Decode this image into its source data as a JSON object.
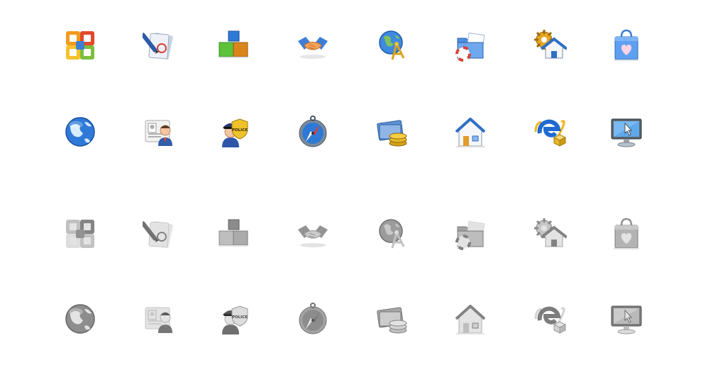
{
  "icon_set": {
    "rows": [
      {
        "style": "color",
        "icons": [
          {
            "name": "office-suite-icon",
            "kind": "office"
          },
          {
            "name": "document-edit-icon",
            "kind": "docedit"
          },
          {
            "name": "blocks-icon",
            "kind": "blocks"
          },
          {
            "name": "handshake-icon",
            "kind": "handshake"
          },
          {
            "name": "globe-network-icon",
            "kind": "globenet"
          },
          {
            "name": "folder-help-icon",
            "kind": "folderhelp"
          },
          {
            "name": "home-settings-icon",
            "kind": "homesettings"
          },
          {
            "name": "shopping-bag-heart-icon",
            "kind": "bag"
          }
        ]
      },
      {
        "style": "color",
        "icons": [
          {
            "name": "globe-icon",
            "kind": "globe"
          },
          {
            "name": "user-id-card-icon",
            "kind": "idcard"
          },
          {
            "name": "police-badge-icon",
            "kind": "police",
            "text": "POLICE"
          },
          {
            "name": "compass-icon",
            "kind": "compass"
          },
          {
            "name": "money-coins-icon",
            "kind": "money"
          },
          {
            "name": "home-icon",
            "kind": "home"
          },
          {
            "name": "internet-explorer-package-icon",
            "kind": "ie"
          },
          {
            "name": "monitor-cursor-icon",
            "kind": "monitor"
          }
        ]
      },
      {
        "style": "gray",
        "icons": [
          {
            "name": "office-suite-icon",
            "kind": "office"
          },
          {
            "name": "document-edit-icon",
            "kind": "docedit"
          },
          {
            "name": "blocks-icon",
            "kind": "blocks"
          },
          {
            "name": "handshake-icon",
            "kind": "handshake"
          },
          {
            "name": "globe-network-icon",
            "kind": "globenet"
          },
          {
            "name": "folder-help-icon",
            "kind": "folderhelp"
          },
          {
            "name": "home-settings-icon",
            "kind": "homesettings"
          },
          {
            "name": "shopping-bag-heart-icon",
            "kind": "bag"
          }
        ]
      },
      {
        "style": "gray",
        "icons": [
          {
            "name": "globe-icon",
            "kind": "globe"
          },
          {
            "name": "user-id-card-icon",
            "kind": "idcard"
          },
          {
            "name": "police-badge-icon",
            "kind": "police",
            "text": "POLICE"
          },
          {
            "name": "compass-icon",
            "kind": "compass"
          },
          {
            "name": "money-coins-icon",
            "kind": "money"
          },
          {
            "name": "home-icon",
            "kind": "home"
          },
          {
            "name": "internet-explorer-package-icon",
            "kind": "ie"
          },
          {
            "name": "monitor-cursor-icon",
            "kind": "monitor"
          }
        ]
      }
    ]
  }
}
